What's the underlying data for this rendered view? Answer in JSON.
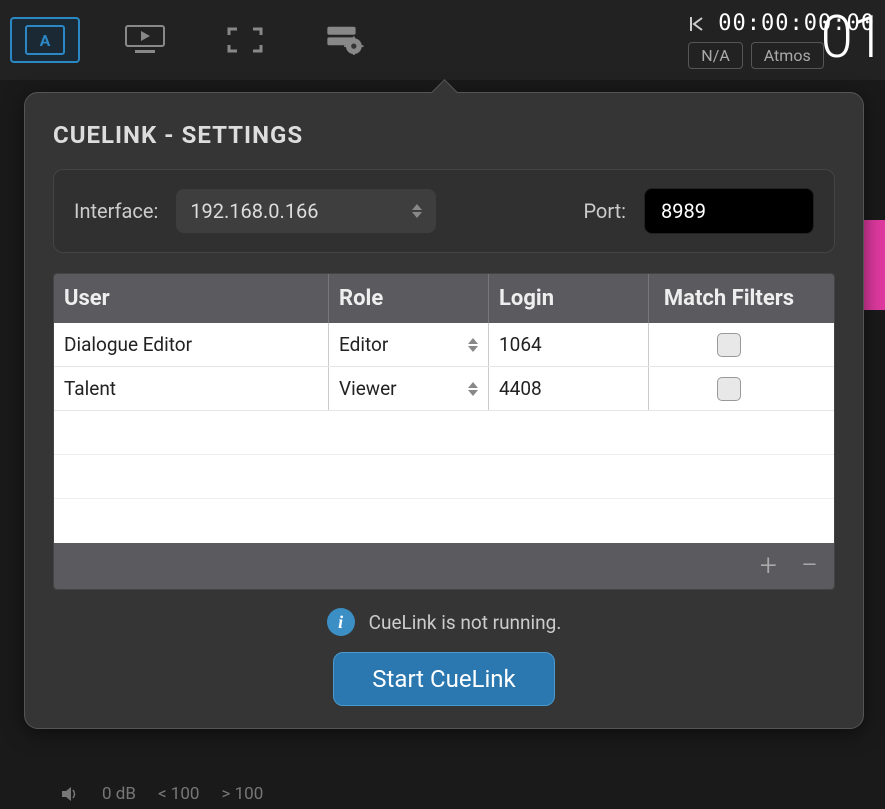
{
  "topbar": {
    "timecode": "00:00:00:00",
    "pill_left": "N/A",
    "pill_right": "Atmos",
    "big_num": "01"
  },
  "panel": {
    "title": "CUELINK - SETTINGS",
    "interface_label": "Interface:",
    "interface_value": "192.168.0.166",
    "port_label": "Port:",
    "port_value": "8989"
  },
  "table": {
    "headers": {
      "user": "User",
      "role": "Role",
      "login": "Login",
      "match": "Match Filters"
    },
    "rows": [
      {
        "user": "Dialogue Editor",
        "role": "Editor",
        "login": "1064",
        "match": false
      },
      {
        "user": "Talent",
        "role": "Viewer",
        "login": "4408",
        "match": false
      }
    ]
  },
  "status": {
    "text": "CueLink is not running."
  },
  "action": {
    "start": "Start CueLink"
  },
  "footer": {
    "db": "0 dB",
    "lt": "< 100",
    "gt": "> 100"
  }
}
